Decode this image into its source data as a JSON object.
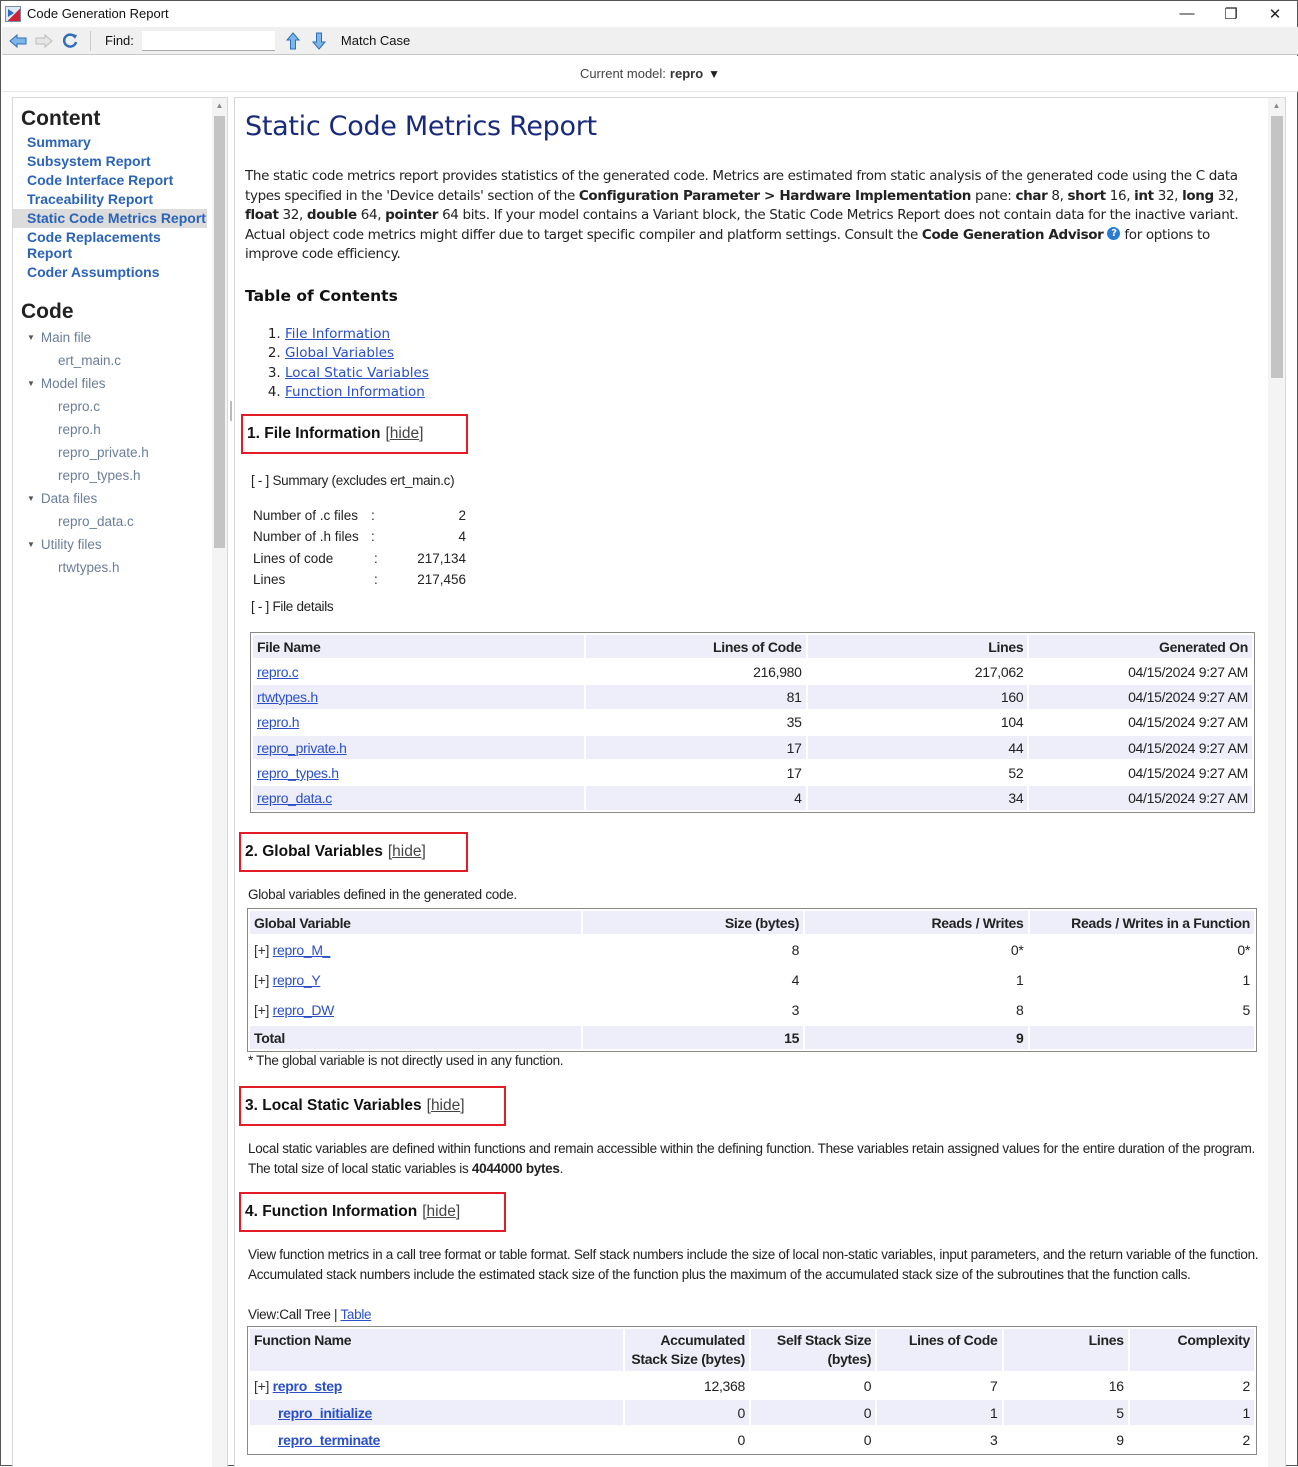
{
  "window": {
    "title": "Code Generation Report",
    "controls": {
      "minimize": "—",
      "restore": "❐",
      "close": "✕"
    }
  },
  "toolbar": {
    "back_icon": "back-arrow-icon",
    "forward_icon": "forward-arrow-icon",
    "refresh_icon": "refresh-icon",
    "find_label": "Find:",
    "find_value": "",
    "find_placeholder": "",
    "find_up_icon": "find-previous-icon",
    "find_down_icon": "find-next-icon",
    "match_case_label": "Match Case"
  },
  "modelbar": {
    "label": "Current model:",
    "model": "repro",
    "caret": "▼"
  },
  "sidebar": {
    "content_heading": "Content",
    "items": [
      {
        "label": "Summary",
        "active": false
      },
      {
        "label": "Subsystem Report",
        "active": false
      },
      {
        "label": "Code Interface Report",
        "active": false
      },
      {
        "label": "Traceability Report",
        "active": false
      },
      {
        "label": "Static Code Metrics Report",
        "active": true
      },
      {
        "label": "Code Replacements Report",
        "active": false
      },
      {
        "label": "Coder Assumptions",
        "active": false
      }
    ],
    "code_heading": "Code",
    "groups": [
      {
        "label": "Main file",
        "files": [
          "ert_main.c"
        ]
      },
      {
        "label": "Model files",
        "files": [
          "repro.c",
          "repro.h",
          "repro_private.h",
          "repro_types.h"
        ]
      },
      {
        "label": "Data files",
        "files": [
          "repro_data.c"
        ]
      },
      {
        "label": "Utility files",
        "files": [
          "rtwtypes.h"
        ]
      }
    ]
  },
  "report": {
    "title": "Static Code Metrics Report",
    "intro": {
      "p1": "The static code metrics report provides statistics of the generated code. Metrics are estimated from static analysis of the generated code using the C data types specified in the 'Device details' section of the ",
      "config_param": "Configuration Parameter > Hardware Implementation",
      "pane": " pane: ",
      "types": [
        {
          "name": "char",
          "bits": " 8, "
        },
        {
          "name": "short",
          "bits": " 16, "
        },
        {
          "name": "int",
          "bits": " 32, "
        },
        {
          "name": "long",
          "bits": " 32, "
        },
        {
          "name": "float",
          "bits": " 32, "
        },
        {
          "name": "double",
          "bits": " 64, "
        },
        {
          "name": "pointer",
          "bits": " 64 bits."
        }
      ],
      "p2": " If your model contains a Variant block, the Static Code Metrics Report does not contain data for the inactive variant. Actual object code metrics might differ due to target specific compiler and platform settings. Consult the ",
      "advisor": "Code Generation Advisor",
      "help_icon": "?",
      "p3": " for options to improve code efficiency."
    },
    "toc": {
      "heading": "Table of Contents",
      "items": [
        "File Information",
        "Global Variables",
        "Local Static Variables",
        "Function Information"
      ]
    },
    "hide_label": "hide",
    "file_info": {
      "heading": "1. File Information",
      "summary_toggle": "[ - ] Summary (excludes ert_main.c)",
      "summary": [
        {
          "key": "Number of .c files",
          "sep": ":",
          "value": "2"
        },
        {
          "key": "Number of .h files",
          "sep": ":",
          "value": "4"
        },
        {
          "key": "Lines of code",
          "sep": ":",
          "value": "217,134"
        },
        {
          "key": "Lines",
          "sep": ":",
          "value": "217,456"
        }
      ],
      "details_toggle": "[ - ] File details",
      "columns": [
        "File Name",
        "Lines of Code",
        "Lines",
        "Generated On"
      ],
      "rows": [
        {
          "file": "repro.c",
          "loc": "216,980",
          "lines": "217,062",
          "generated": "04/15/2024 9:27 AM"
        },
        {
          "file": "rtwtypes.h",
          "loc": "81",
          "lines": "160",
          "generated": "04/15/2024 9:27 AM"
        },
        {
          "file": "repro.h",
          "loc": "35",
          "lines": "104",
          "generated": "04/15/2024 9:27 AM"
        },
        {
          "file": "repro_private.h",
          "loc": "17",
          "lines": "44",
          "generated": "04/15/2024 9:27 AM"
        },
        {
          "file": "repro_types.h",
          "loc": "17",
          "lines": "52",
          "generated": "04/15/2024 9:27 AM"
        },
        {
          "file": "repro_data.c",
          "loc": "4",
          "lines": "34",
          "generated": "04/15/2024 9:27 AM"
        }
      ]
    },
    "global_vars": {
      "heading": "2. Global Variables",
      "description": "Global variables defined in the generated code.",
      "columns": [
        "Global Variable",
        "Size (bytes)",
        "Reads / Writes",
        "Reads / Writes in a Function"
      ],
      "expander": "[+]",
      "rows": [
        {
          "name": "repro_M_",
          "size": "8",
          "rw": "0*",
          "rw_fn": "0*"
        },
        {
          "name": "repro_Y",
          "size": "4",
          "rw": "1",
          "rw_fn": "1"
        },
        {
          "name": "repro_DW",
          "size": "3",
          "rw": "8",
          "rw_fn": "5"
        }
      ],
      "total": {
        "label": "Total",
        "size": "15",
        "rw": "9",
        "rw_fn": ""
      },
      "footnote": "* The global variable is not directly used in any function."
    },
    "local_static": {
      "heading": "3. Local Static Variables",
      "description": "Local static variables are defined within functions and remain accessible within the defining function. These variables retain assigned values for the entire duration of the program. The total size of local static variables is ",
      "total_size": "4044000 bytes",
      "end": "."
    },
    "function_info": {
      "heading": "4. Function Information",
      "description": "View function metrics in a call tree format or table format. Self stack numbers include the size of local non-static variables, input parameters, and the return variable of the function. Accumulated stack numbers include the estimated stack size of the function plus the maximum of the accumulated stack size of the subroutines that the function calls.",
      "view_label": "View:",
      "view_current": "Call Tree",
      "view_sep": " | ",
      "view_alt": "Table",
      "columns": [
        "Function Name",
        "Accumulated Stack Size (bytes)",
        "Self Stack Size (bytes)",
        "Lines of Code",
        "Lines",
        "Complexity"
      ],
      "column_lines": [
        [
          "Function Name"
        ],
        [
          "Accumulated",
          "Stack Size (bytes)"
        ],
        [
          "Self Stack Size",
          "(bytes)"
        ],
        [
          "Lines of Code"
        ],
        [
          "Lines"
        ],
        [
          "Complexity"
        ]
      ],
      "rows": [
        {
          "expander": "[+]",
          "name": "repro_step",
          "acc_stack": "12,368",
          "self_stack": "0",
          "loc": "7",
          "lines": "16",
          "complexity": "2"
        },
        {
          "expander": "",
          "name": "repro_initialize",
          "acc_stack": "0",
          "self_stack": "0",
          "loc": "1",
          "lines": "5",
          "complexity": "1"
        },
        {
          "expander": "",
          "name": "repro_terminate",
          "acc_stack": "0",
          "self_stack": "0",
          "loc": "3",
          "lines": "9",
          "complexity": "2"
        }
      ]
    }
  },
  "colors": {
    "link": "#2a4fc8",
    "nav_link": "#2a63b8",
    "title": "#1a2a7a",
    "highlight_box": "#e21b24",
    "table_header_bg": "#eeeefa"
  }
}
